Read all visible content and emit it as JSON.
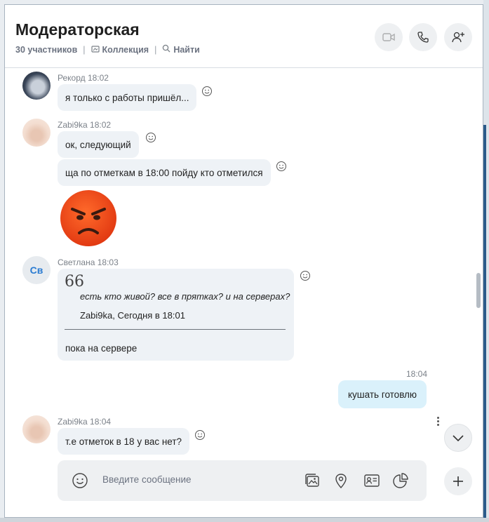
{
  "header": {
    "title": "Модераторская",
    "participants": "30 участников",
    "collection": "Коллекция",
    "find": "Найти"
  },
  "messages": {
    "m1": {
      "sender": "Рекорд 18:02",
      "text": "я только с работы пришёл..."
    },
    "m2": {
      "sender": "Zabi9ka 18:02",
      "text1": "ок, следующий",
      "text2": "ща по отметкам в 18:00 пойду кто отметился"
    },
    "m3": {
      "initials": "Св",
      "sender": "Светлана 18:03",
      "quote_mark": "66",
      "quote_text": "есть кто живой? все в прятках? и на серверах?",
      "quote_source": "Zabi9ka, Сегодня в 18:01",
      "reply": "пока на сервере"
    },
    "m4": {
      "time": "18:04",
      "text": "кушать готовлю"
    },
    "m5": {
      "sender": "Zabi9ka 18:04",
      "text": "т.е отметок в 18 у вас нет?"
    }
  },
  "composer": {
    "placeholder": "Введите сообщение"
  },
  "colors": {
    "accent": "#2a7bd1",
    "bubble_in": "#eef2f6",
    "bubble_out": "#daf1fb"
  }
}
